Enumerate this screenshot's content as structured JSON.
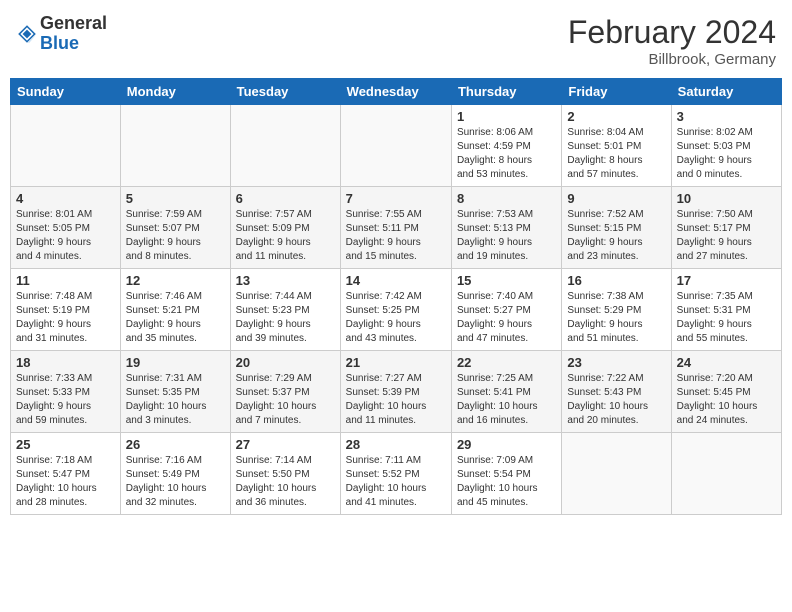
{
  "header": {
    "logo_general": "General",
    "logo_blue": "Blue",
    "month_title": "February 2024",
    "location": "Billbrook, Germany"
  },
  "days_of_week": [
    "Sunday",
    "Monday",
    "Tuesday",
    "Wednesday",
    "Thursday",
    "Friday",
    "Saturday"
  ],
  "weeks": [
    [
      {
        "day": "",
        "info": ""
      },
      {
        "day": "",
        "info": ""
      },
      {
        "day": "",
        "info": ""
      },
      {
        "day": "",
        "info": ""
      },
      {
        "day": "1",
        "info": "Sunrise: 8:06 AM\nSunset: 4:59 PM\nDaylight: 8 hours\nand 53 minutes."
      },
      {
        "day": "2",
        "info": "Sunrise: 8:04 AM\nSunset: 5:01 PM\nDaylight: 8 hours\nand 57 minutes."
      },
      {
        "day": "3",
        "info": "Sunrise: 8:02 AM\nSunset: 5:03 PM\nDaylight: 9 hours\nand 0 minutes."
      }
    ],
    [
      {
        "day": "4",
        "info": "Sunrise: 8:01 AM\nSunset: 5:05 PM\nDaylight: 9 hours\nand 4 minutes."
      },
      {
        "day": "5",
        "info": "Sunrise: 7:59 AM\nSunset: 5:07 PM\nDaylight: 9 hours\nand 8 minutes."
      },
      {
        "day": "6",
        "info": "Sunrise: 7:57 AM\nSunset: 5:09 PM\nDaylight: 9 hours\nand 11 minutes."
      },
      {
        "day": "7",
        "info": "Sunrise: 7:55 AM\nSunset: 5:11 PM\nDaylight: 9 hours\nand 15 minutes."
      },
      {
        "day": "8",
        "info": "Sunrise: 7:53 AM\nSunset: 5:13 PM\nDaylight: 9 hours\nand 19 minutes."
      },
      {
        "day": "9",
        "info": "Sunrise: 7:52 AM\nSunset: 5:15 PM\nDaylight: 9 hours\nand 23 minutes."
      },
      {
        "day": "10",
        "info": "Sunrise: 7:50 AM\nSunset: 5:17 PM\nDaylight: 9 hours\nand 27 minutes."
      }
    ],
    [
      {
        "day": "11",
        "info": "Sunrise: 7:48 AM\nSunset: 5:19 PM\nDaylight: 9 hours\nand 31 minutes."
      },
      {
        "day": "12",
        "info": "Sunrise: 7:46 AM\nSunset: 5:21 PM\nDaylight: 9 hours\nand 35 minutes."
      },
      {
        "day": "13",
        "info": "Sunrise: 7:44 AM\nSunset: 5:23 PM\nDaylight: 9 hours\nand 39 minutes."
      },
      {
        "day": "14",
        "info": "Sunrise: 7:42 AM\nSunset: 5:25 PM\nDaylight: 9 hours\nand 43 minutes."
      },
      {
        "day": "15",
        "info": "Sunrise: 7:40 AM\nSunset: 5:27 PM\nDaylight: 9 hours\nand 47 minutes."
      },
      {
        "day": "16",
        "info": "Sunrise: 7:38 AM\nSunset: 5:29 PM\nDaylight: 9 hours\nand 51 minutes."
      },
      {
        "day": "17",
        "info": "Sunrise: 7:35 AM\nSunset: 5:31 PM\nDaylight: 9 hours\nand 55 minutes."
      }
    ],
    [
      {
        "day": "18",
        "info": "Sunrise: 7:33 AM\nSunset: 5:33 PM\nDaylight: 9 hours\nand 59 minutes."
      },
      {
        "day": "19",
        "info": "Sunrise: 7:31 AM\nSunset: 5:35 PM\nDaylight: 10 hours\nand 3 minutes."
      },
      {
        "day": "20",
        "info": "Sunrise: 7:29 AM\nSunset: 5:37 PM\nDaylight: 10 hours\nand 7 minutes."
      },
      {
        "day": "21",
        "info": "Sunrise: 7:27 AM\nSunset: 5:39 PM\nDaylight: 10 hours\nand 11 minutes."
      },
      {
        "day": "22",
        "info": "Sunrise: 7:25 AM\nSunset: 5:41 PM\nDaylight: 10 hours\nand 16 minutes."
      },
      {
        "day": "23",
        "info": "Sunrise: 7:22 AM\nSunset: 5:43 PM\nDaylight: 10 hours\nand 20 minutes."
      },
      {
        "day": "24",
        "info": "Sunrise: 7:20 AM\nSunset: 5:45 PM\nDaylight: 10 hours\nand 24 minutes."
      }
    ],
    [
      {
        "day": "25",
        "info": "Sunrise: 7:18 AM\nSunset: 5:47 PM\nDaylight: 10 hours\nand 28 minutes."
      },
      {
        "day": "26",
        "info": "Sunrise: 7:16 AM\nSunset: 5:49 PM\nDaylight: 10 hours\nand 32 minutes."
      },
      {
        "day": "27",
        "info": "Sunrise: 7:14 AM\nSunset: 5:50 PM\nDaylight: 10 hours\nand 36 minutes."
      },
      {
        "day": "28",
        "info": "Sunrise: 7:11 AM\nSunset: 5:52 PM\nDaylight: 10 hours\nand 41 minutes."
      },
      {
        "day": "29",
        "info": "Sunrise: 7:09 AM\nSunset: 5:54 PM\nDaylight: 10 hours\nand 45 minutes."
      },
      {
        "day": "",
        "info": ""
      },
      {
        "day": "",
        "info": ""
      }
    ]
  ]
}
